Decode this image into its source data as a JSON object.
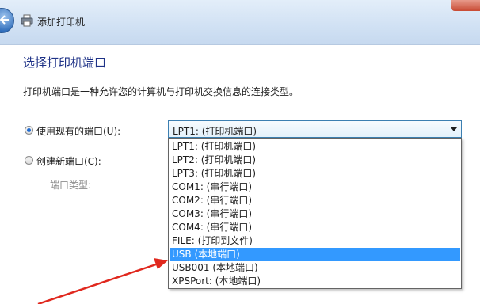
{
  "window": {
    "title": "添加打印机"
  },
  "page": {
    "heading": "选择打印机端口",
    "description": "打印机端口是一种允许您的计算机与打印机交换信息的连接类型。",
    "use_existing_label": "使用现有的端口(U):",
    "create_new_label": "创建新端口(C):",
    "port_type_label": "端口类型:"
  },
  "port_select": {
    "value": "LPT1: (打印机端口)",
    "options": [
      "LPT1: (打印机端口)",
      "LPT2: (打印机端口)",
      "LPT3: (打印机端口)",
      "COM1: (串行端口)",
      "COM2: (串行端口)",
      "COM3: (串行端口)",
      "COM4: (串行端口)",
      "FILE: (打印到文件)",
      "USB (本地端口)",
      "USB001 (本地端口)",
      "XPSPort: (本地端口)"
    ],
    "highlighted": "USB (本地端口)"
  },
  "colors": {
    "heading": "#1e3287",
    "highlight": "#3399ff",
    "annotation_arrow": "#e0281e"
  }
}
